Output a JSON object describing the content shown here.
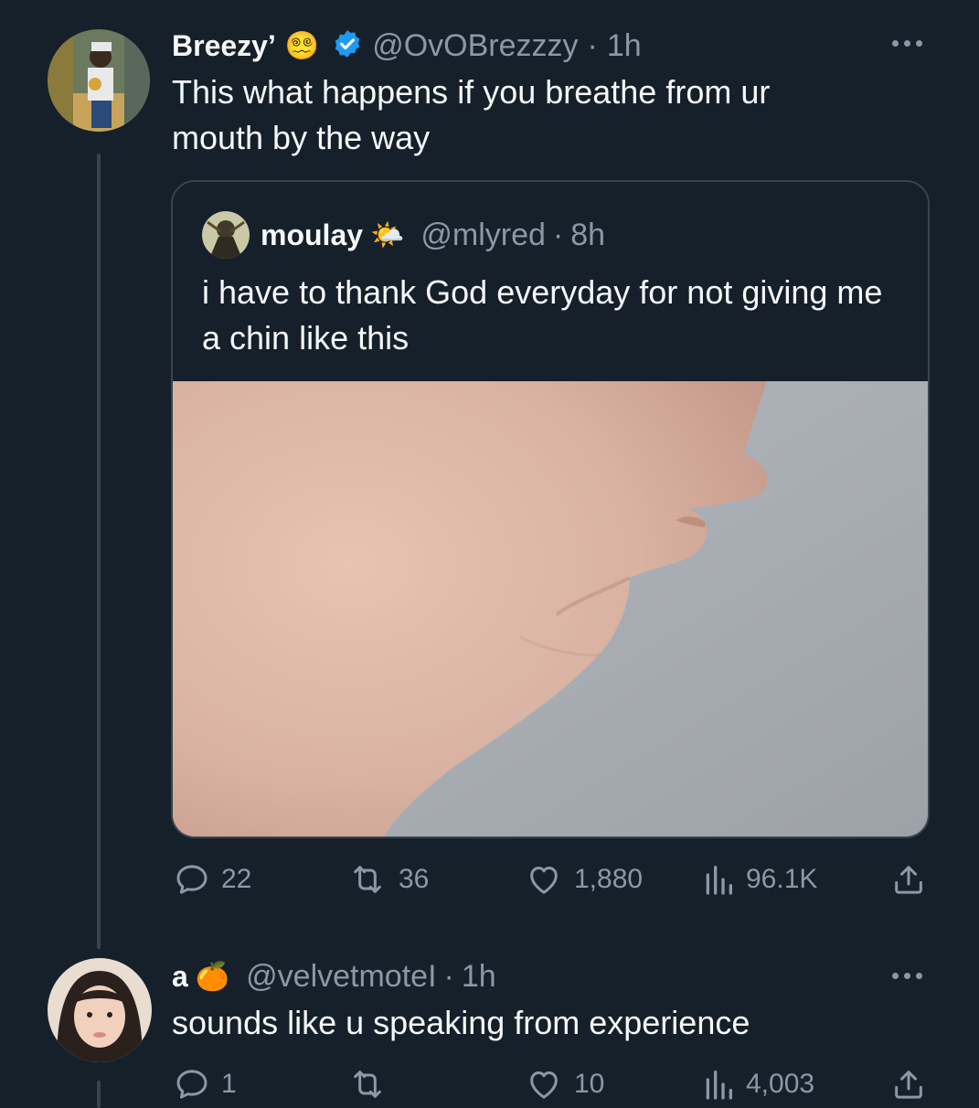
{
  "tweet": {
    "author_name": "Breezy’",
    "name_emoji": "😵‍💫",
    "handle": "@OvOBrezzzy",
    "separator": "·",
    "time": "1h",
    "text": "This what happens if you breathe from ur mouth by the way"
  },
  "quote": {
    "author_name": "moulay",
    "name_emoji": "🌤️",
    "handle": "@mlyred",
    "separator": "·",
    "time": "8h",
    "text": "i have to thank God everyday for not giving me a chin like this"
  },
  "actions": {
    "replies": "22",
    "reposts": "36",
    "likes": "1,880",
    "views": "96.1K"
  },
  "reply": {
    "author_name": "a",
    "name_emoji": "🍊",
    "handle": "@velvetmoteI",
    "separator": "·",
    "time": "1h",
    "text": "sounds like u speaking from experience",
    "actions": {
      "replies": "1",
      "reposts": "",
      "likes": "10",
      "views": "4,003"
    }
  },
  "colors": {
    "background": "#15202b",
    "border": "#38444d",
    "muted": "#8b98a5",
    "verified": "#1d9bf0"
  }
}
